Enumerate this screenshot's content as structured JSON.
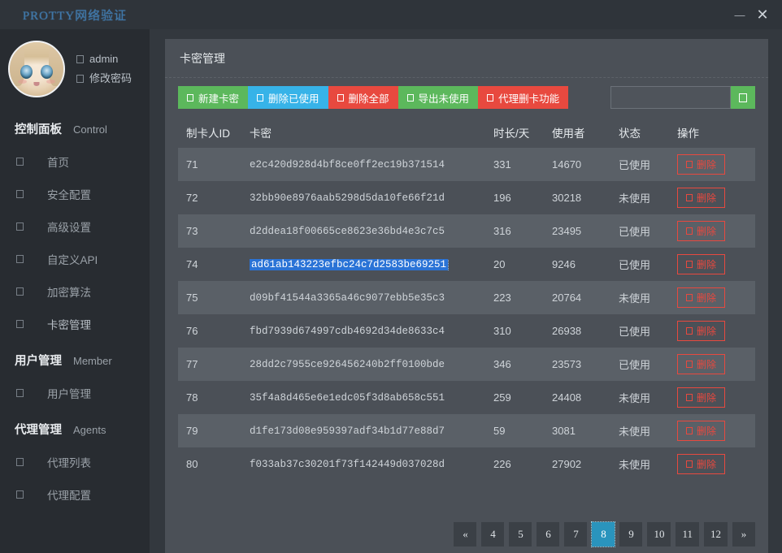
{
  "window": {
    "logo_text": "PROTTY网络验证",
    "minimize_label": "—",
    "close_label": "✕"
  },
  "sidebar": {
    "profile": {
      "username": "admin",
      "change_password": "修改密码"
    },
    "groups": [
      {
        "cn": "控制面板",
        "en": "Control",
        "items": [
          {
            "label": "首页",
            "active": false
          },
          {
            "label": "安全配置",
            "active": false
          },
          {
            "label": "高级设置",
            "active": false
          },
          {
            "label": "自定义API",
            "active": false
          },
          {
            "label": "加密算法",
            "active": false
          },
          {
            "label": "卡密管理",
            "active": true
          }
        ]
      },
      {
        "cn": "用户管理",
        "en": "Member",
        "items": [
          {
            "label": "用户管理",
            "active": false
          }
        ]
      },
      {
        "cn": "代理管理",
        "en": "Agents",
        "items": [
          {
            "label": "代理列表",
            "active": false
          },
          {
            "label": "代理配置",
            "active": false
          }
        ]
      }
    ]
  },
  "main": {
    "panel_title": "卡密管理",
    "toolbar": {
      "buttons": [
        {
          "label": "新建卡密",
          "color": "green"
        },
        {
          "label": "删除已使用",
          "color": "blue"
        },
        {
          "label": "删除全部",
          "color": "red"
        },
        {
          "label": "导出未使用",
          "color": "green"
        },
        {
          "label": "代理删卡功能",
          "color": "red"
        }
      ],
      "search_value": "",
      "search_placeholder": ""
    },
    "table": {
      "columns": [
        "制卡人ID",
        "卡密",
        "时长/天",
        "使用者",
        "状态",
        "操作"
      ],
      "action_label": "删除",
      "rows": [
        {
          "id": "71",
          "key": "e2c420d928d4bf8ce0ff2ec19b371514",
          "days": "331",
          "user": "14670",
          "state": "已使用",
          "selected": false
        },
        {
          "id": "72",
          "key": "32bb90e8976aab5298d5da10fe66f21d",
          "days": "196",
          "user": "30218",
          "state": "未使用",
          "selected": false
        },
        {
          "id": "73",
          "key": "d2ddea18f00665ce8623e36bd4e3c7c5",
          "days": "316",
          "user": "23495",
          "state": "已使用",
          "selected": false
        },
        {
          "id": "74",
          "key": "ad61ab143223efbc24c7d2583be69251",
          "days": "20",
          "user": "9246",
          "state": "已使用",
          "selected": true
        },
        {
          "id": "75",
          "key": "d09bf41544a3365a46c9077ebb5e35c3",
          "days": "223",
          "user": "20764",
          "state": "未使用",
          "selected": false
        },
        {
          "id": "76",
          "key": "fbd7939d674997cdb4692d34de8633c4",
          "days": "310",
          "user": "26938",
          "state": "已使用",
          "selected": false
        },
        {
          "id": "77",
          "key": "28dd2c7955ce926456240b2ff0100bde",
          "days": "346",
          "user": "23573",
          "state": "已使用",
          "selected": false
        },
        {
          "id": "78",
          "key": "35f4a8d465e6e1edc05f3d8ab658c551",
          "days": "259",
          "user": "24408",
          "state": "未使用",
          "selected": false
        },
        {
          "id": "79",
          "key": "d1fe173d08e959397adf34b1d77e88d7",
          "days": "59",
          "user": "3081",
          "state": "未使用",
          "selected": false
        },
        {
          "id": "80",
          "key": "f033ab37c30201f73f142449d037028d",
          "days": "226",
          "user": "27902",
          "state": "未使用",
          "selected": false
        }
      ]
    },
    "pagination": {
      "prev": "«",
      "next": "»",
      "pages": [
        "4",
        "5",
        "6",
        "7",
        "8",
        "9",
        "10",
        "11",
        "12"
      ],
      "current": "8"
    }
  },
  "colors": {
    "green": "#5cb85c",
    "blue": "#37b3e8",
    "red": "#e8493f",
    "active_page": "#2a94bd",
    "selection": "#2a73d6"
  }
}
